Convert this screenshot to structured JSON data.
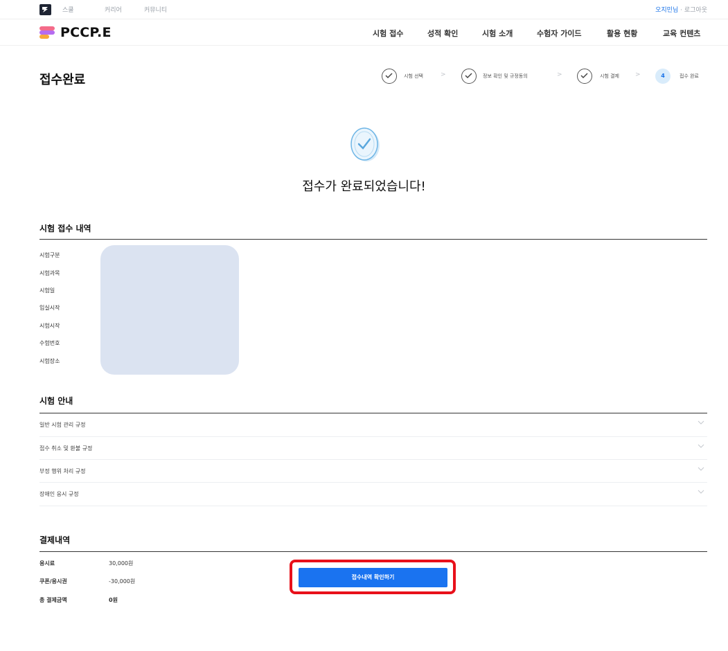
{
  "topbar": {
    "links": [
      "스쿨",
      "커리어",
      "커뮤니티"
    ],
    "user_name": "오지민님",
    "separator": "·",
    "logout": "로그아웃"
  },
  "header": {
    "brand": "PCCP.E",
    "brand_colors": [
      "#f46b8a",
      "#b56cf0",
      "#f7a93b"
    ],
    "nav": [
      "시험 접수",
      "성적 확인",
      "시험 소개",
      "수험자 가이드",
      "활용 현황",
      "교육 컨텐츠"
    ]
  },
  "page": {
    "title": "접수완료",
    "steps": [
      {
        "label": "시험 선택",
        "state": "done"
      },
      {
        "label": "정보 확인 및 규정동의",
        "state": "done"
      },
      {
        "label": "시험 결제",
        "state": "done"
      },
      {
        "number": "4",
        "label": "접수 완료",
        "state": "current"
      }
    ],
    "step_separator": ">"
  },
  "success": {
    "message": "접수가 완료되었습니다!",
    "icon": "check-badge-icon"
  },
  "registration": {
    "title": "시험 접수 내역",
    "fields": [
      "시험구분",
      "시험과목",
      "시험일",
      "입실시작",
      "시험시작",
      "수험번호",
      "시험장소"
    ]
  },
  "guide": {
    "title": "시험 안내",
    "items": [
      "일반 시험 관리 규정",
      "접수 취소 및 환불 규정",
      "부정 행위 처리 규정",
      "장애인 응시 규정"
    ]
  },
  "payment": {
    "title": "결제내역",
    "rows": [
      {
        "label": "응시료",
        "value": "30,000원"
      },
      {
        "label": "쿠폰/응시권",
        "value": "-30,000원"
      },
      {
        "label": "총 결제금액",
        "value": "0원"
      }
    ]
  },
  "actions": {
    "confirm_label": "접수내역 확인하기"
  },
  "colors": {
    "accent": "#1a73f0",
    "highlight": "#e8101a",
    "redaction": "#dbe3f1"
  }
}
